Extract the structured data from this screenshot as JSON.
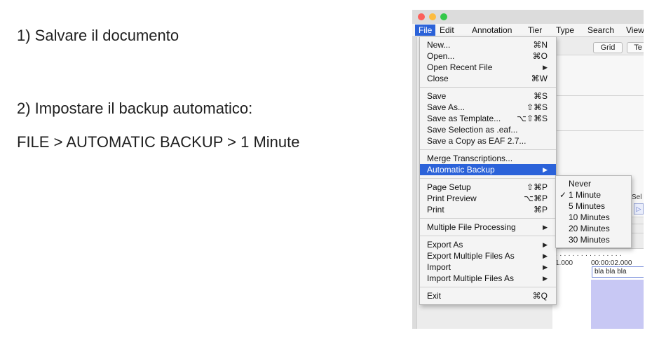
{
  "slide": {
    "step1": "1) Salvare il documento",
    "step2": "2) Impostare il backup automatico:",
    "step2_path": "FILE > AUTOMATIC BACKUP > 1 Minute"
  },
  "menubar": {
    "items": [
      "File",
      "Edit",
      "Annotation",
      "Tier",
      "Type",
      "Search",
      "View"
    ],
    "active": "File"
  },
  "background": {
    "grid_button": "Grid",
    "text_button": "Te",
    "sel_label": "Sel",
    "play_glyph": "▷",
    "tl_time_left": "1.000",
    "tl_time": "00:00:02.000",
    "annotation_text": "bla bla bla"
  },
  "file_menu": {
    "items": [
      {
        "label": "New...",
        "shortcut": "⌘N"
      },
      {
        "label": "Open...",
        "shortcut": "⌘O"
      },
      {
        "label": "Open Recent File",
        "submenu": true
      },
      {
        "label": "Close",
        "shortcut": "⌘W"
      },
      {
        "label": "Save",
        "shortcut": "⌘S"
      },
      {
        "label": "Save As...",
        "shortcut": "⇧⌘S"
      },
      {
        "label": "Save as Template...",
        "shortcut": "⌥⇧⌘S"
      },
      {
        "label": "Save Selection as .eaf..."
      },
      {
        "label": "Save a Copy as EAF 2.7..."
      },
      {
        "label": "Merge Transcriptions..."
      },
      {
        "label": "Automatic Backup",
        "submenu": true,
        "highlighted": true
      },
      {
        "label": "Page Setup",
        "shortcut": "⇧⌘P"
      },
      {
        "label": "Print Preview",
        "shortcut": "⌥⌘P"
      },
      {
        "label": "Print",
        "shortcut": "⌘P"
      },
      {
        "label": "Multiple File Processing",
        "submenu": true
      },
      {
        "label": "Export As",
        "submenu": true
      },
      {
        "label": "Export Multiple Files As",
        "submenu": true
      },
      {
        "label": "Import",
        "submenu": true
      },
      {
        "label": "Import Multiple Files As",
        "submenu": true
      },
      {
        "label": "Exit",
        "shortcut": "⌘Q"
      }
    ],
    "submenu_arrow": "▶"
  },
  "backup_submenu": {
    "items": [
      "Never",
      "1 Minute",
      "5 Minutes",
      "10 Minutes",
      "20 Minutes",
      "30 Minutes"
    ],
    "checked": "1 Minute",
    "check_glyph": "✓"
  },
  "colors": {
    "highlight": "#2b62d9",
    "selection_area": "#c8c8f4"
  }
}
